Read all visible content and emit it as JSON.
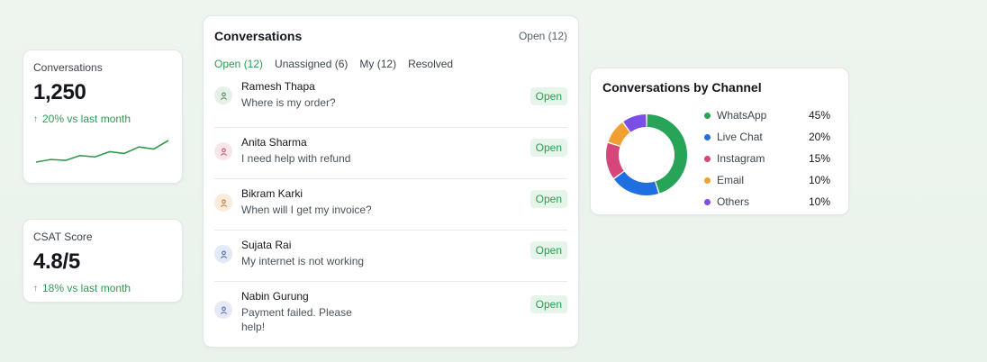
{
  "kpis": {
    "conversations": {
      "label": "Conversations",
      "value": "1,250",
      "delta": "20% vs last month",
      "trend": [
        0,
        0.12,
        0.08,
        0.3,
        0.24,
        0.48,
        0.4,
        0.7,
        0.6,
        1.0
      ]
    },
    "csat": {
      "label": "CSAT Score",
      "value": "4.8/5",
      "delta": "18% vs last month"
    }
  },
  "conversations": {
    "title": "Conversations",
    "count_label": "Open (12)",
    "tabs": [
      {
        "label": "Open (12)",
        "active": true
      },
      {
        "label": "Unassigned (6)",
        "active": false
      },
      {
        "label": "My (12)",
        "active": false
      },
      {
        "label": "Resolved",
        "active": false
      }
    ],
    "items": [
      {
        "name": "Ramesh Thapa",
        "message": "Where is my order?",
        "status": "Open",
        "avatar_color": "#4b8a5a",
        "avatar_bg": "#e7efe9"
      },
      {
        "name": "Anita Sharma",
        "message": "I need help with refund",
        "status": "Open",
        "avatar_color": "#c2506a",
        "avatar_bg": "#f9e6ea"
      },
      {
        "name": "Bikram Karki",
        "message": "When will I get my invoice?",
        "status": "Open",
        "avatar_color": "#c9793f",
        "avatar_bg": "#fbebdc"
      },
      {
        "name": "Sujata Rai",
        "message": "My internet is not working",
        "status": "Open",
        "avatar_color": "#3f69b0",
        "avatar_bg": "#e3eaf6"
      },
      {
        "name": "Nabin Gurung",
        "message": "Payment failed. Please help!",
        "status": "Open",
        "avatar_color": "#5a63b8",
        "avatar_bg": "#e7e9f7"
      }
    ]
  },
  "chart_data": {
    "type": "pie",
    "title": "Conversations by Channel",
    "series": [
      {
        "name": "WhatsApp",
        "value": 45,
        "label": "45%",
        "color": "#27a457"
      },
      {
        "name": "Live Chat",
        "value": 20,
        "label": "20%",
        "color": "#1f6fe0"
      },
      {
        "name": "Instagram",
        "value": 15,
        "label": "15%",
        "color": "#d6467a"
      },
      {
        "name": "Email",
        "value": 10,
        "label": "10%",
        "color": "#f0a030"
      },
      {
        "name": "Others",
        "value": 10,
        "label": "10%",
        "color": "#7b4fe6"
      }
    ]
  },
  "colors": {
    "accent": "#2e9b52",
    "badge_bg": "#e6f4ea"
  },
  "icons": {
    "delta": "arrow-up-icon",
    "avatar": "user-icon"
  }
}
